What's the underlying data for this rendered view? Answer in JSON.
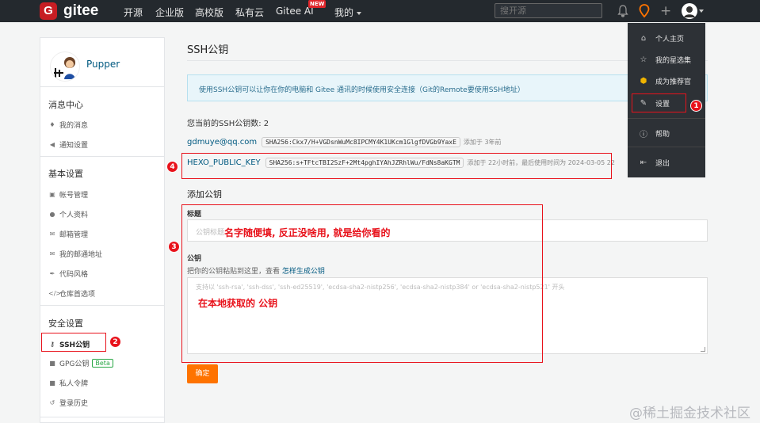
{
  "nav": {
    "logo_letter": "G",
    "logo_text": "gitee",
    "items": [
      "开源",
      "企业版",
      "高校版",
      "私有云",
      "Gitee AI",
      "我的"
    ],
    "new_badge": "NEW",
    "search_placeholder": "搜开源"
  },
  "sidebar": {
    "username": "Pupper",
    "sections": [
      {
        "title": "消息中心",
        "items": [
          {
            "icon": "bell-icon",
            "label": "我的消息"
          },
          {
            "icon": "sound-icon",
            "label": "通知设置"
          }
        ]
      },
      {
        "title": "基本设置",
        "items": [
          {
            "icon": "id-card-icon",
            "label": "帐号管理"
          },
          {
            "icon": "user-icon",
            "label": "个人资料"
          },
          {
            "icon": "mail-icon",
            "label": "邮箱管理"
          },
          {
            "icon": "mail-icon",
            "label": "我的邮通地址"
          },
          {
            "icon": "brush-icon",
            "label": "代码风格"
          },
          {
            "icon": "code-icon",
            "label": "仓库首选项"
          }
        ]
      },
      {
        "title": "安全设置",
        "items": [
          {
            "icon": "key-icon",
            "label": "SSH公钥"
          },
          {
            "icon": "lock-icon",
            "label": "GPG公钥"
          },
          {
            "icon": "lock-icon",
            "label": "私人令牌"
          },
          {
            "icon": "history-icon",
            "label": "登录历史"
          }
        ]
      }
    ],
    "gpg_badge": "Beta"
  },
  "main": {
    "title": "SSH公钥",
    "info": "使用SSH公钥可以让你在你的电脑和 Gitee 通讯的时候使用安全连接（Git的Remote要使用SSH地址）",
    "count_label": "您当前的SSH公钥数: 2",
    "keys": [
      {
        "name": "gdmuye@qq.com",
        "fingerprint": "SHA256:Ckx7/H+VGDsnWuMc8IPCMY4K1UKcm1GlgfDVGb9YaxE",
        "meta": "添加于 3年前"
      },
      {
        "name": "HEXO_PUBLIC_KEY",
        "fingerprint": "SHA256:s+TFtcTBI2SzF+2Mt4pghIYAhJZRhlWu/FdNs8aKGTM",
        "meta": "添加于 22小时前，最后使用时间为 2024-03-05 22"
      }
    ],
    "add_title": "添加公钥",
    "title_label": "标题",
    "title_placeholder": "公钥标题",
    "key_label": "公钥",
    "key_hint_prefix": "把你的公钥粘贴到这里，查看 ",
    "key_hint_link": "怎样生成公钥",
    "key_placeholder": "支持以 'ssh-rsa', 'ssh-dss', 'ssh-ed25519', 'ecdsa-sha2-nistp256', 'ecdsa-sha2-nistp384' or 'ecdsa-sha2-nistp521' 开头",
    "submit": "确定"
  },
  "annotations": {
    "title_note": "名字随便填, 反正没啥用, 就是给你看的",
    "key_note": "在本地获取的 公钥",
    "numbers": [
      "1",
      "2",
      "3",
      "4"
    ]
  },
  "dropdown": [
    {
      "icon": "home-icon",
      "label": "个人主页"
    },
    {
      "icon": "star-icon",
      "label": "我的星选集"
    },
    {
      "icon": "badge-icon",
      "label": "成为推荐官"
    },
    {
      "icon": "edit-icon",
      "label": "设置"
    },
    {
      "icon": "help-icon",
      "label": "帮助"
    },
    {
      "icon": "logout-icon",
      "label": "退出"
    }
  ],
  "watermark": "@稀土掘金技术社区",
  "colors": {
    "brand": "#c71d23",
    "navbar": "#24292e",
    "accent": "#fe7300",
    "annotation": "#e8121b"
  }
}
